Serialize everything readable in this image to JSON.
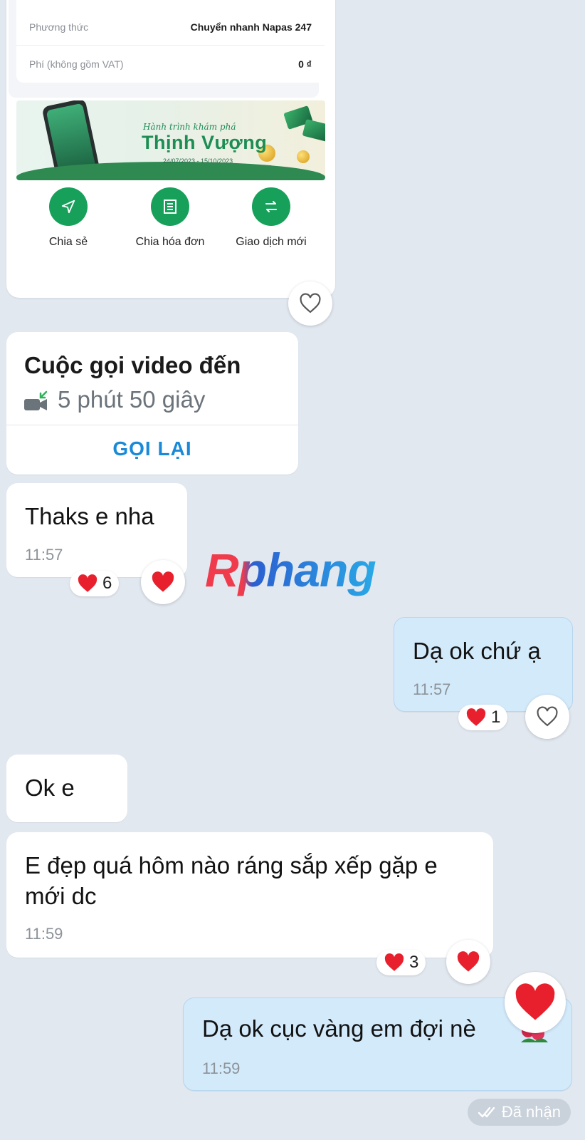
{
  "receipt": {
    "rows": [
      {
        "label": "Phương thức",
        "value": "Chuyển nhanh Napas 247"
      },
      {
        "label": "Phí (không gồm VAT)",
        "value": "0 ₫"
      }
    ],
    "banner": {
      "script_text": "Hành trình khám phá",
      "title": "Thịnh Vượng",
      "dates": "24/07/2023 - 15/10/2023"
    },
    "actions": [
      {
        "label": "Chia sẻ",
        "icon": "send-icon"
      },
      {
        "label": "Chia hóa đơn",
        "icon": "receipt-icon"
      },
      {
        "label": "Giao dịch mới",
        "icon": "swap-icon"
      }
    ]
  },
  "call": {
    "title": "Cuộc gọi video đến",
    "duration": "5 phút 50 giây",
    "call_back": "GỌI LẠI",
    "icon": "incoming-video-icon"
  },
  "messages": [
    {
      "text": "Thaks e nha",
      "time": "11:57",
      "reaction_count": "6"
    },
    {
      "text": "Dạ ok chứ ạ",
      "time": "11:57",
      "reaction_count": "1"
    },
    {
      "text": "Ok e"
    },
    {
      "text": "E đẹp quá hôm nào ráng sắp xếp gặp e mới dc",
      "time": "11:59",
      "reaction_count": "3"
    },
    {
      "text": "Dạ ok cục vàng em đợi nè",
      "time": "11:59"
    }
  ],
  "watermark": "Rphang",
  "status": {
    "received": "Đã nhận"
  },
  "colors": {
    "background": "#e2e8f0",
    "accent_green": "#17a05a",
    "link_blue": "#1a8ad8",
    "my_bubble": "#d3eafb",
    "heart_red": "#e8202d"
  }
}
